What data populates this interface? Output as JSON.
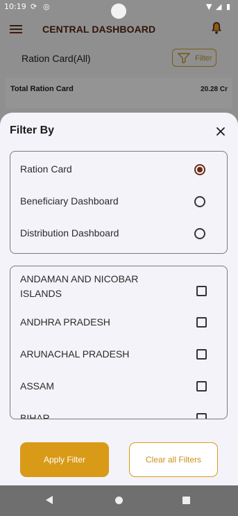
{
  "status_bar": {
    "time": "10:19"
  },
  "header": {
    "title": "CENTRAL DASHBOARD"
  },
  "subheader": {
    "title": "Ration Card(All)",
    "filter_label": "Filter"
  },
  "summary": {
    "label": "Total Ration Card",
    "value": "20.28 Cr"
  },
  "sheet": {
    "title": "Filter By",
    "dashboard_options": [
      {
        "label": "Ration Card",
        "selected": true
      },
      {
        "label": "Beneficiary Dashboard",
        "selected": false
      },
      {
        "label": "Distribution Dashboard",
        "selected": false
      }
    ],
    "states": [
      "ANDAMAN AND NICOBAR ISLANDS",
      "ANDHRA PRADESH",
      "ARUNACHAL PRADESH",
      "ASSAM",
      "BIHAR"
    ],
    "apply_label": "Apply Filter",
    "clear_label": "Clear all Filters"
  },
  "colors": {
    "accent": "#d99a17",
    "brand": "#6b2b14"
  }
}
